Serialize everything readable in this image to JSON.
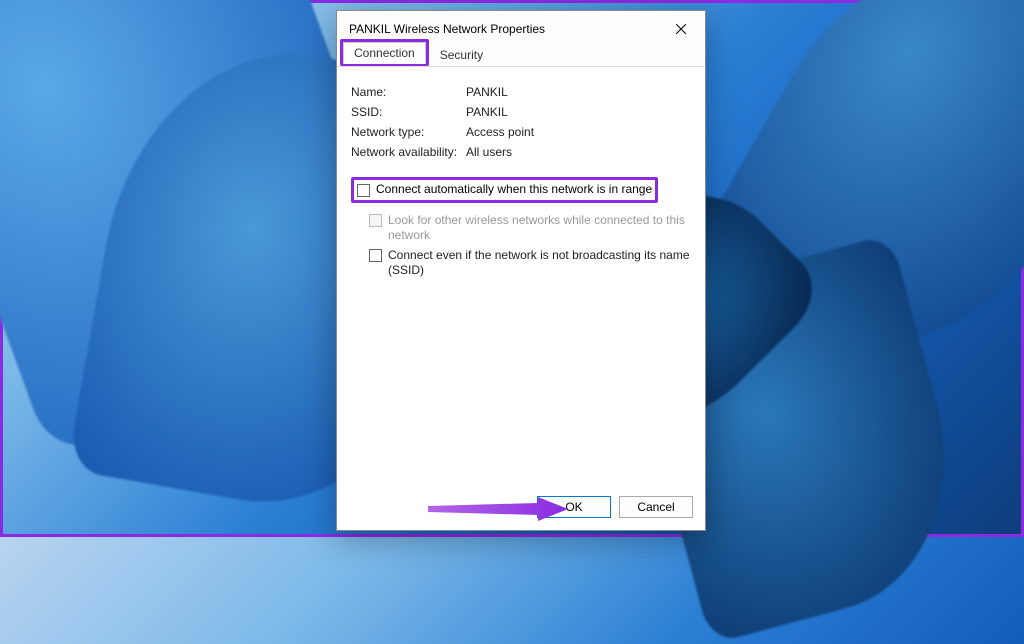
{
  "dialog": {
    "title": "PANKIL Wireless Network Properties",
    "tabs": {
      "connection": "Connection",
      "security": "Security"
    },
    "fields": {
      "name_label": "Name:",
      "name_value": "PANKIL",
      "ssid_label": "SSID:",
      "ssid_value": "PANKIL",
      "type_label": "Network type:",
      "type_value": "Access point",
      "avail_label": "Network availability:",
      "avail_value": "All users"
    },
    "checkboxes": {
      "auto_connect": "Connect automatically when this network is in range",
      "look_other": "Look for other wireless networks while connected to this network",
      "connect_hidden": "Connect even if the network is not broadcasting its name (SSID)"
    },
    "buttons": {
      "ok": "OK",
      "cancel": "Cancel"
    }
  },
  "annotation": {
    "highlight_color": "#8a2be2"
  }
}
